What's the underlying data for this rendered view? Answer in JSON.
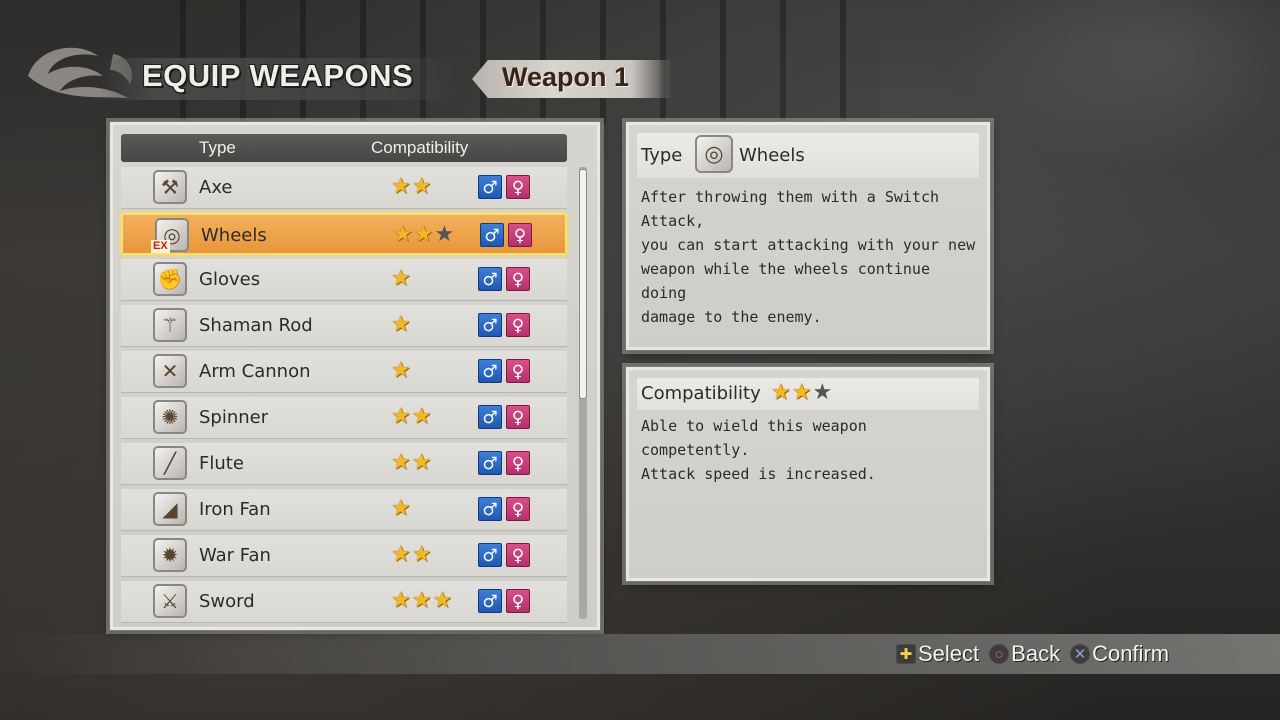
{
  "header": {
    "title": "EQUIP WEAPONS",
    "tab_label": "Weapon 1"
  },
  "list": {
    "col_type": "Type",
    "col_compat": "Compatibility",
    "selected_index": 1,
    "items": [
      {
        "name": "Axe",
        "icon": "axe-icon",
        "glyph": "⚒",
        "stars_filled": 2,
        "stars_empty": 0,
        "ex": false
      },
      {
        "name": "Wheels",
        "icon": "wheels-icon",
        "glyph": "◎",
        "stars_filled": 2,
        "stars_empty": 1,
        "ex": true,
        "ex_label": "EX"
      },
      {
        "name": "Gloves",
        "icon": "gloves-icon",
        "glyph": "✊",
        "stars_filled": 1,
        "stars_empty": 0,
        "ex": false
      },
      {
        "name": "Shaman Rod",
        "icon": "shaman-rod-icon",
        "glyph": "⚚",
        "stars_filled": 1,
        "stars_empty": 0,
        "ex": false
      },
      {
        "name": "Arm Cannon",
        "icon": "arm-cannon-icon",
        "glyph": "✕",
        "stars_filled": 1,
        "stars_empty": 0,
        "ex": false
      },
      {
        "name": "Spinner",
        "icon": "spinner-icon",
        "glyph": "✺",
        "stars_filled": 2,
        "stars_empty": 0,
        "ex": false
      },
      {
        "name": "Flute",
        "icon": "flute-icon",
        "glyph": "╱",
        "stars_filled": 2,
        "stars_empty": 0,
        "ex": false
      },
      {
        "name": "Iron Fan",
        "icon": "iron-fan-icon",
        "glyph": "◢",
        "stars_filled": 1,
        "stars_empty": 0,
        "ex": false
      },
      {
        "name": "War Fan",
        "icon": "war-fan-icon",
        "glyph": "✹",
        "stars_filled": 2,
        "stars_empty": 0,
        "ex": false
      },
      {
        "name": "Sword",
        "icon": "sword-icon",
        "glyph": "⚔",
        "stars_filled": 3,
        "stars_empty": 0,
        "ex": false
      }
    ],
    "male_symbol": "♂",
    "female_symbol": "♀"
  },
  "type_panel": {
    "label": "Type",
    "weapon_name": "Wheels",
    "icon": "wheels-icon",
    "glyph": "◎",
    "description": "After throwing them with a Switch Attack,\nyou can start attacking with your new\nweapon while the wheels continue doing\ndamage to the enemy."
  },
  "compat_panel": {
    "label": "Compatibility",
    "stars_filled": 2,
    "stars_empty": 1,
    "description": "Able to wield this weapon competently.\nAttack speed is increased."
  },
  "footer": {
    "select_label": "Select",
    "back_label": "Back",
    "confirm_label": "Confirm"
  },
  "colors": {
    "selected_row": "#eda148",
    "star": "#f3b825",
    "male": "#1f58b2",
    "female": "#b5306a"
  }
}
